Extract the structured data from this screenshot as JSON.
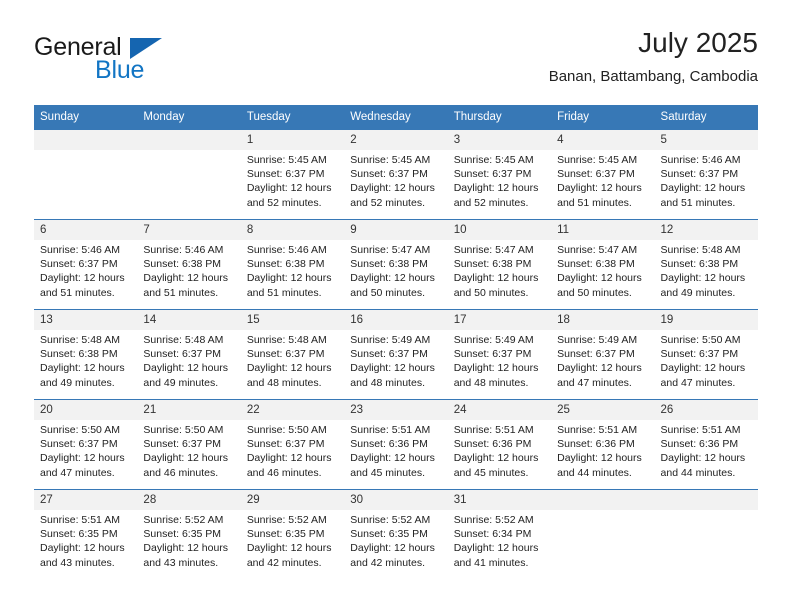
{
  "brand": {
    "name_part1": "General",
    "name_part2": "Blue",
    "flag_color": "#1565b0",
    "blue_color": "#1275c4"
  },
  "header": {
    "title": "July 2025",
    "subtitle": "Banan, Battambang, Cambodia"
  },
  "calendar": {
    "accent_color": "#3778b6",
    "daynum_bg": "#f2f2f2",
    "weekday_headers": [
      "Sunday",
      "Monday",
      "Tuesday",
      "Wednesday",
      "Thursday",
      "Friday",
      "Saturday"
    ],
    "weeks": [
      [
        {
          "day": "",
          "empty": true
        },
        {
          "day": "",
          "empty": true
        },
        {
          "day": "1",
          "sunrise": "Sunrise: 5:45 AM",
          "sunset": "Sunset: 6:37 PM",
          "daylight1": "Daylight: 12 hours",
          "daylight2": "and 52 minutes."
        },
        {
          "day": "2",
          "sunrise": "Sunrise: 5:45 AM",
          "sunset": "Sunset: 6:37 PM",
          "daylight1": "Daylight: 12 hours",
          "daylight2": "and 52 minutes."
        },
        {
          "day": "3",
          "sunrise": "Sunrise: 5:45 AM",
          "sunset": "Sunset: 6:37 PM",
          "daylight1": "Daylight: 12 hours",
          "daylight2": "and 52 minutes."
        },
        {
          "day": "4",
          "sunrise": "Sunrise: 5:45 AM",
          "sunset": "Sunset: 6:37 PM",
          "daylight1": "Daylight: 12 hours",
          "daylight2": "and 51 minutes."
        },
        {
          "day": "5",
          "sunrise": "Sunrise: 5:46 AM",
          "sunset": "Sunset: 6:37 PM",
          "daylight1": "Daylight: 12 hours",
          "daylight2": "and 51 minutes."
        }
      ],
      [
        {
          "day": "6",
          "sunrise": "Sunrise: 5:46 AM",
          "sunset": "Sunset: 6:37 PM",
          "daylight1": "Daylight: 12 hours",
          "daylight2": "and 51 minutes."
        },
        {
          "day": "7",
          "sunrise": "Sunrise: 5:46 AM",
          "sunset": "Sunset: 6:38 PM",
          "daylight1": "Daylight: 12 hours",
          "daylight2": "and 51 minutes."
        },
        {
          "day": "8",
          "sunrise": "Sunrise: 5:46 AM",
          "sunset": "Sunset: 6:38 PM",
          "daylight1": "Daylight: 12 hours",
          "daylight2": "and 51 minutes."
        },
        {
          "day": "9",
          "sunrise": "Sunrise: 5:47 AM",
          "sunset": "Sunset: 6:38 PM",
          "daylight1": "Daylight: 12 hours",
          "daylight2": "and 50 minutes."
        },
        {
          "day": "10",
          "sunrise": "Sunrise: 5:47 AM",
          "sunset": "Sunset: 6:38 PM",
          "daylight1": "Daylight: 12 hours",
          "daylight2": "and 50 minutes."
        },
        {
          "day": "11",
          "sunrise": "Sunrise: 5:47 AM",
          "sunset": "Sunset: 6:38 PM",
          "daylight1": "Daylight: 12 hours",
          "daylight2": "and 50 minutes."
        },
        {
          "day": "12",
          "sunrise": "Sunrise: 5:48 AM",
          "sunset": "Sunset: 6:38 PM",
          "daylight1": "Daylight: 12 hours",
          "daylight2": "and 49 minutes."
        }
      ],
      [
        {
          "day": "13",
          "sunrise": "Sunrise: 5:48 AM",
          "sunset": "Sunset: 6:38 PM",
          "daylight1": "Daylight: 12 hours",
          "daylight2": "and 49 minutes."
        },
        {
          "day": "14",
          "sunrise": "Sunrise: 5:48 AM",
          "sunset": "Sunset: 6:37 PM",
          "daylight1": "Daylight: 12 hours",
          "daylight2": "and 49 minutes."
        },
        {
          "day": "15",
          "sunrise": "Sunrise: 5:48 AM",
          "sunset": "Sunset: 6:37 PM",
          "daylight1": "Daylight: 12 hours",
          "daylight2": "and 48 minutes."
        },
        {
          "day": "16",
          "sunrise": "Sunrise: 5:49 AM",
          "sunset": "Sunset: 6:37 PM",
          "daylight1": "Daylight: 12 hours",
          "daylight2": "and 48 minutes."
        },
        {
          "day": "17",
          "sunrise": "Sunrise: 5:49 AM",
          "sunset": "Sunset: 6:37 PM",
          "daylight1": "Daylight: 12 hours",
          "daylight2": "and 48 minutes."
        },
        {
          "day": "18",
          "sunrise": "Sunrise: 5:49 AM",
          "sunset": "Sunset: 6:37 PM",
          "daylight1": "Daylight: 12 hours",
          "daylight2": "and 47 minutes."
        },
        {
          "day": "19",
          "sunrise": "Sunrise: 5:50 AM",
          "sunset": "Sunset: 6:37 PM",
          "daylight1": "Daylight: 12 hours",
          "daylight2": "and 47 minutes."
        }
      ],
      [
        {
          "day": "20",
          "sunrise": "Sunrise: 5:50 AM",
          "sunset": "Sunset: 6:37 PM",
          "daylight1": "Daylight: 12 hours",
          "daylight2": "and 47 minutes."
        },
        {
          "day": "21",
          "sunrise": "Sunrise: 5:50 AM",
          "sunset": "Sunset: 6:37 PM",
          "daylight1": "Daylight: 12 hours",
          "daylight2": "and 46 minutes."
        },
        {
          "day": "22",
          "sunrise": "Sunrise: 5:50 AM",
          "sunset": "Sunset: 6:37 PM",
          "daylight1": "Daylight: 12 hours",
          "daylight2": "and 46 minutes."
        },
        {
          "day": "23",
          "sunrise": "Sunrise: 5:51 AM",
          "sunset": "Sunset: 6:36 PM",
          "daylight1": "Daylight: 12 hours",
          "daylight2": "and 45 minutes."
        },
        {
          "day": "24",
          "sunrise": "Sunrise: 5:51 AM",
          "sunset": "Sunset: 6:36 PM",
          "daylight1": "Daylight: 12 hours",
          "daylight2": "and 45 minutes."
        },
        {
          "day": "25",
          "sunrise": "Sunrise: 5:51 AM",
          "sunset": "Sunset: 6:36 PM",
          "daylight1": "Daylight: 12 hours",
          "daylight2": "and 44 minutes."
        },
        {
          "day": "26",
          "sunrise": "Sunrise: 5:51 AM",
          "sunset": "Sunset: 6:36 PM",
          "daylight1": "Daylight: 12 hours",
          "daylight2": "and 44 minutes."
        }
      ],
      [
        {
          "day": "27",
          "sunrise": "Sunrise: 5:51 AM",
          "sunset": "Sunset: 6:35 PM",
          "daylight1": "Daylight: 12 hours",
          "daylight2": "and 43 minutes."
        },
        {
          "day": "28",
          "sunrise": "Sunrise: 5:52 AM",
          "sunset": "Sunset: 6:35 PM",
          "daylight1": "Daylight: 12 hours",
          "daylight2": "and 43 minutes."
        },
        {
          "day": "29",
          "sunrise": "Sunrise: 5:52 AM",
          "sunset": "Sunset: 6:35 PM",
          "daylight1": "Daylight: 12 hours",
          "daylight2": "and 42 minutes."
        },
        {
          "day": "30",
          "sunrise": "Sunrise: 5:52 AM",
          "sunset": "Sunset: 6:35 PM",
          "daylight1": "Daylight: 12 hours",
          "daylight2": "and 42 minutes."
        },
        {
          "day": "31",
          "sunrise": "Sunrise: 5:52 AM",
          "sunset": "Sunset: 6:34 PM",
          "daylight1": "Daylight: 12 hours",
          "daylight2": "and 41 minutes."
        },
        {
          "day": "",
          "empty": true
        },
        {
          "day": "",
          "empty": true
        }
      ]
    ]
  }
}
